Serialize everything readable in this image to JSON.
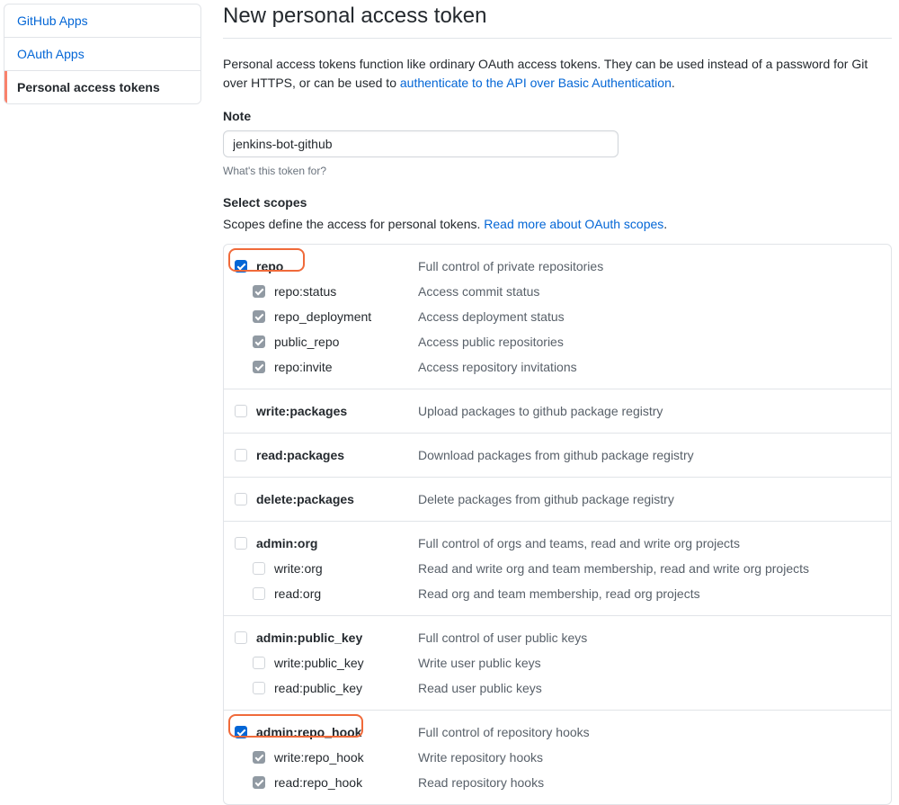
{
  "sidebar": {
    "items": [
      {
        "label": "GitHub Apps",
        "active": false
      },
      {
        "label": "OAuth Apps",
        "active": false
      },
      {
        "label": "Personal access tokens",
        "active": true
      }
    ]
  },
  "page": {
    "title": "New personal access token",
    "intro_pre": "Personal access tokens function like ordinary OAuth access tokens. They can be used instead of a password for Git over HTTPS, or can be used to ",
    "intro_link": "authenticate to the API over Basic Authentication",
    "intro_post": "."
  },
  "note": {
    "label": "Note",
    "value": "jenkins-bot-github",
    "hint": "What's this token for?"
  },
  "scopes": {
    "heading": "Select scopes",
    "intro_pre": "Scopes define the access for personal tokens. ",
    "intro_link": "Read more about OAuth scopes",
    "intro_post": "."
  },
  "scope_groups": [
    {
      "highlight": true,
      "highlight_width": 85,
      "parent": {
        "name": "repo",
        "desc": "Full control of private repositories",
        "checked": true,
        "disabled": false
      },
      "children": [
        {
          "name": "repo:status",
          "desc": "Access commit status",
          "checked": true,
          "disabled": true
        },
        {
          "name": "repo_deployment",
          "desc": "Access deployment status",
          "checked": true,
          "disabled": true
        },
        {
          "name": "public_repo",
          "desc": "Access public repositories",
          "checked": true,
          "disabled": true
        },
        {
          "name": "repo:invite",
          "desc": "Access repository invitations",
          "checked": true,
          "disabled": true
        }
      ]
    },
    {
      "parent": {
        "name": "write:packages",
        "desc": "Upload packages to github package registry",
        "checked": false,
        "disabled": false
      },
      "children": []
    },
    {
      "parent": {
        "name": "read:packages",
        "desc": "Download packages from github package registry",
        "checked": false,
        "disabled": false
      },
      "children": []
    },
    {
      "parent": {
        "name": "delete:packages",
        "desc": "Delete packages from github package registry",
        "checked": false,
        "disabled": false
      },
      "children": []
    },
    {
      "parent": {
        "name": "admin:org",
        "desc": "Full control of orgs and teams, read and write org projects",
        "checked": false,
        "disabled": false
      },
      "children": [
        {
          "name": "write:org",
          "desc": "Read and write org and team membership, read and write org projects",
          "checked": false,
          "disabled": false
        },
        {
          "name": "read:org",
          "desc": "Read org and team membership, read org projects",
          "checked": false,
          "disabled": false
        }
      ]
    },
    {
      "parent": {
        "name": "admin:public_key",
        "desc": "Full control of user public keys",
        "checked": false,
        "disabled": false
      },
      "children": [
        {
          "name": "write:public_key",
          "desc": "Write user public keys",
          "checked": false,
          "disabled": false
        },
        {
          "name": "read:public_key",
          "desc": "Read user public keys",
          "checked": false,
          "disabled": false
        }
      ]
    },
    {
      "highlight": true,
      "highlight_width": 150,
      "parent": {
        "name": "admin:repo_hook",
        "desc": "Full control of repository hooks",
        "checked": true,
        "disabled": false
      },
      "children": [
        {
          "name": "write:repo_hook",
          "desc": "Write repository hooks",
          "checked": true,
          "disabled": true
        },
        {
          "name": "read:repo_hook",
          "desc": "Read repository hooks",
          "checked": true,
          "disabled": true
        }
      ]
    }
  ]
}
